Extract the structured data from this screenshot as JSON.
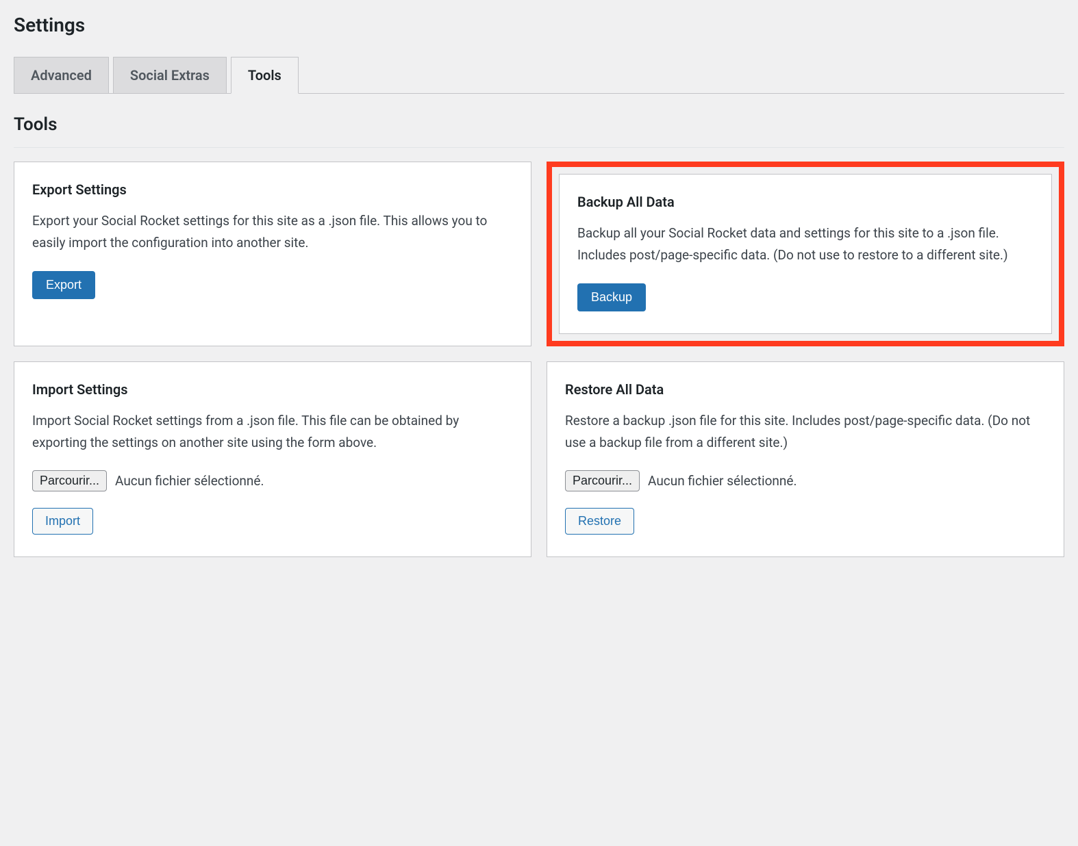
{
  "page": {
    "title": "Settings",
    "section": "Tools"
  },
  "tabs": [
    {
      "label": "Advanced",
      "active": false
    },
    {
      "label": "Social Extras",
      "active": false
    },
    {
      "label": "Tools",
      "active": true
    }
  ],
  "cards": {
    "export": {
      "title": "Export Settings",
      "desc": "Export your Social Rocket settings for this site as a .json file. This allows you to easily import the configuration into another site.",
      "button": "Export"
    },
    "backup": {
      "title": "Backup All Data",
      "desc": "Backup all your Social Rocket data and settings for this site to a .json file. Includes post/page-specific data. (Do not use to restore to a different site.)",
      "button": "Backup"
    },
    "import": {
      "title": "Import Settings",
      "desc": "Import Social Rocket settings from a .json file. This file can be obtained by exporting the settings on another site using the form above.",
      "browse": "Parcourir...",
      "file_status": "Aucun fichier sélectionné.",
      "button": "Import"
    },
    "restore": {
      "title": "Restore All Data",
      "desc": "Restore a backup .json file for this site. Includes post/page-specific data. (Do not use a backup file from a different site.)",
      "browse": "Parcourir...",
      "file_status": "Aucun fichier sélectionné.",
      "button": "Restore"
    }
  }
}
